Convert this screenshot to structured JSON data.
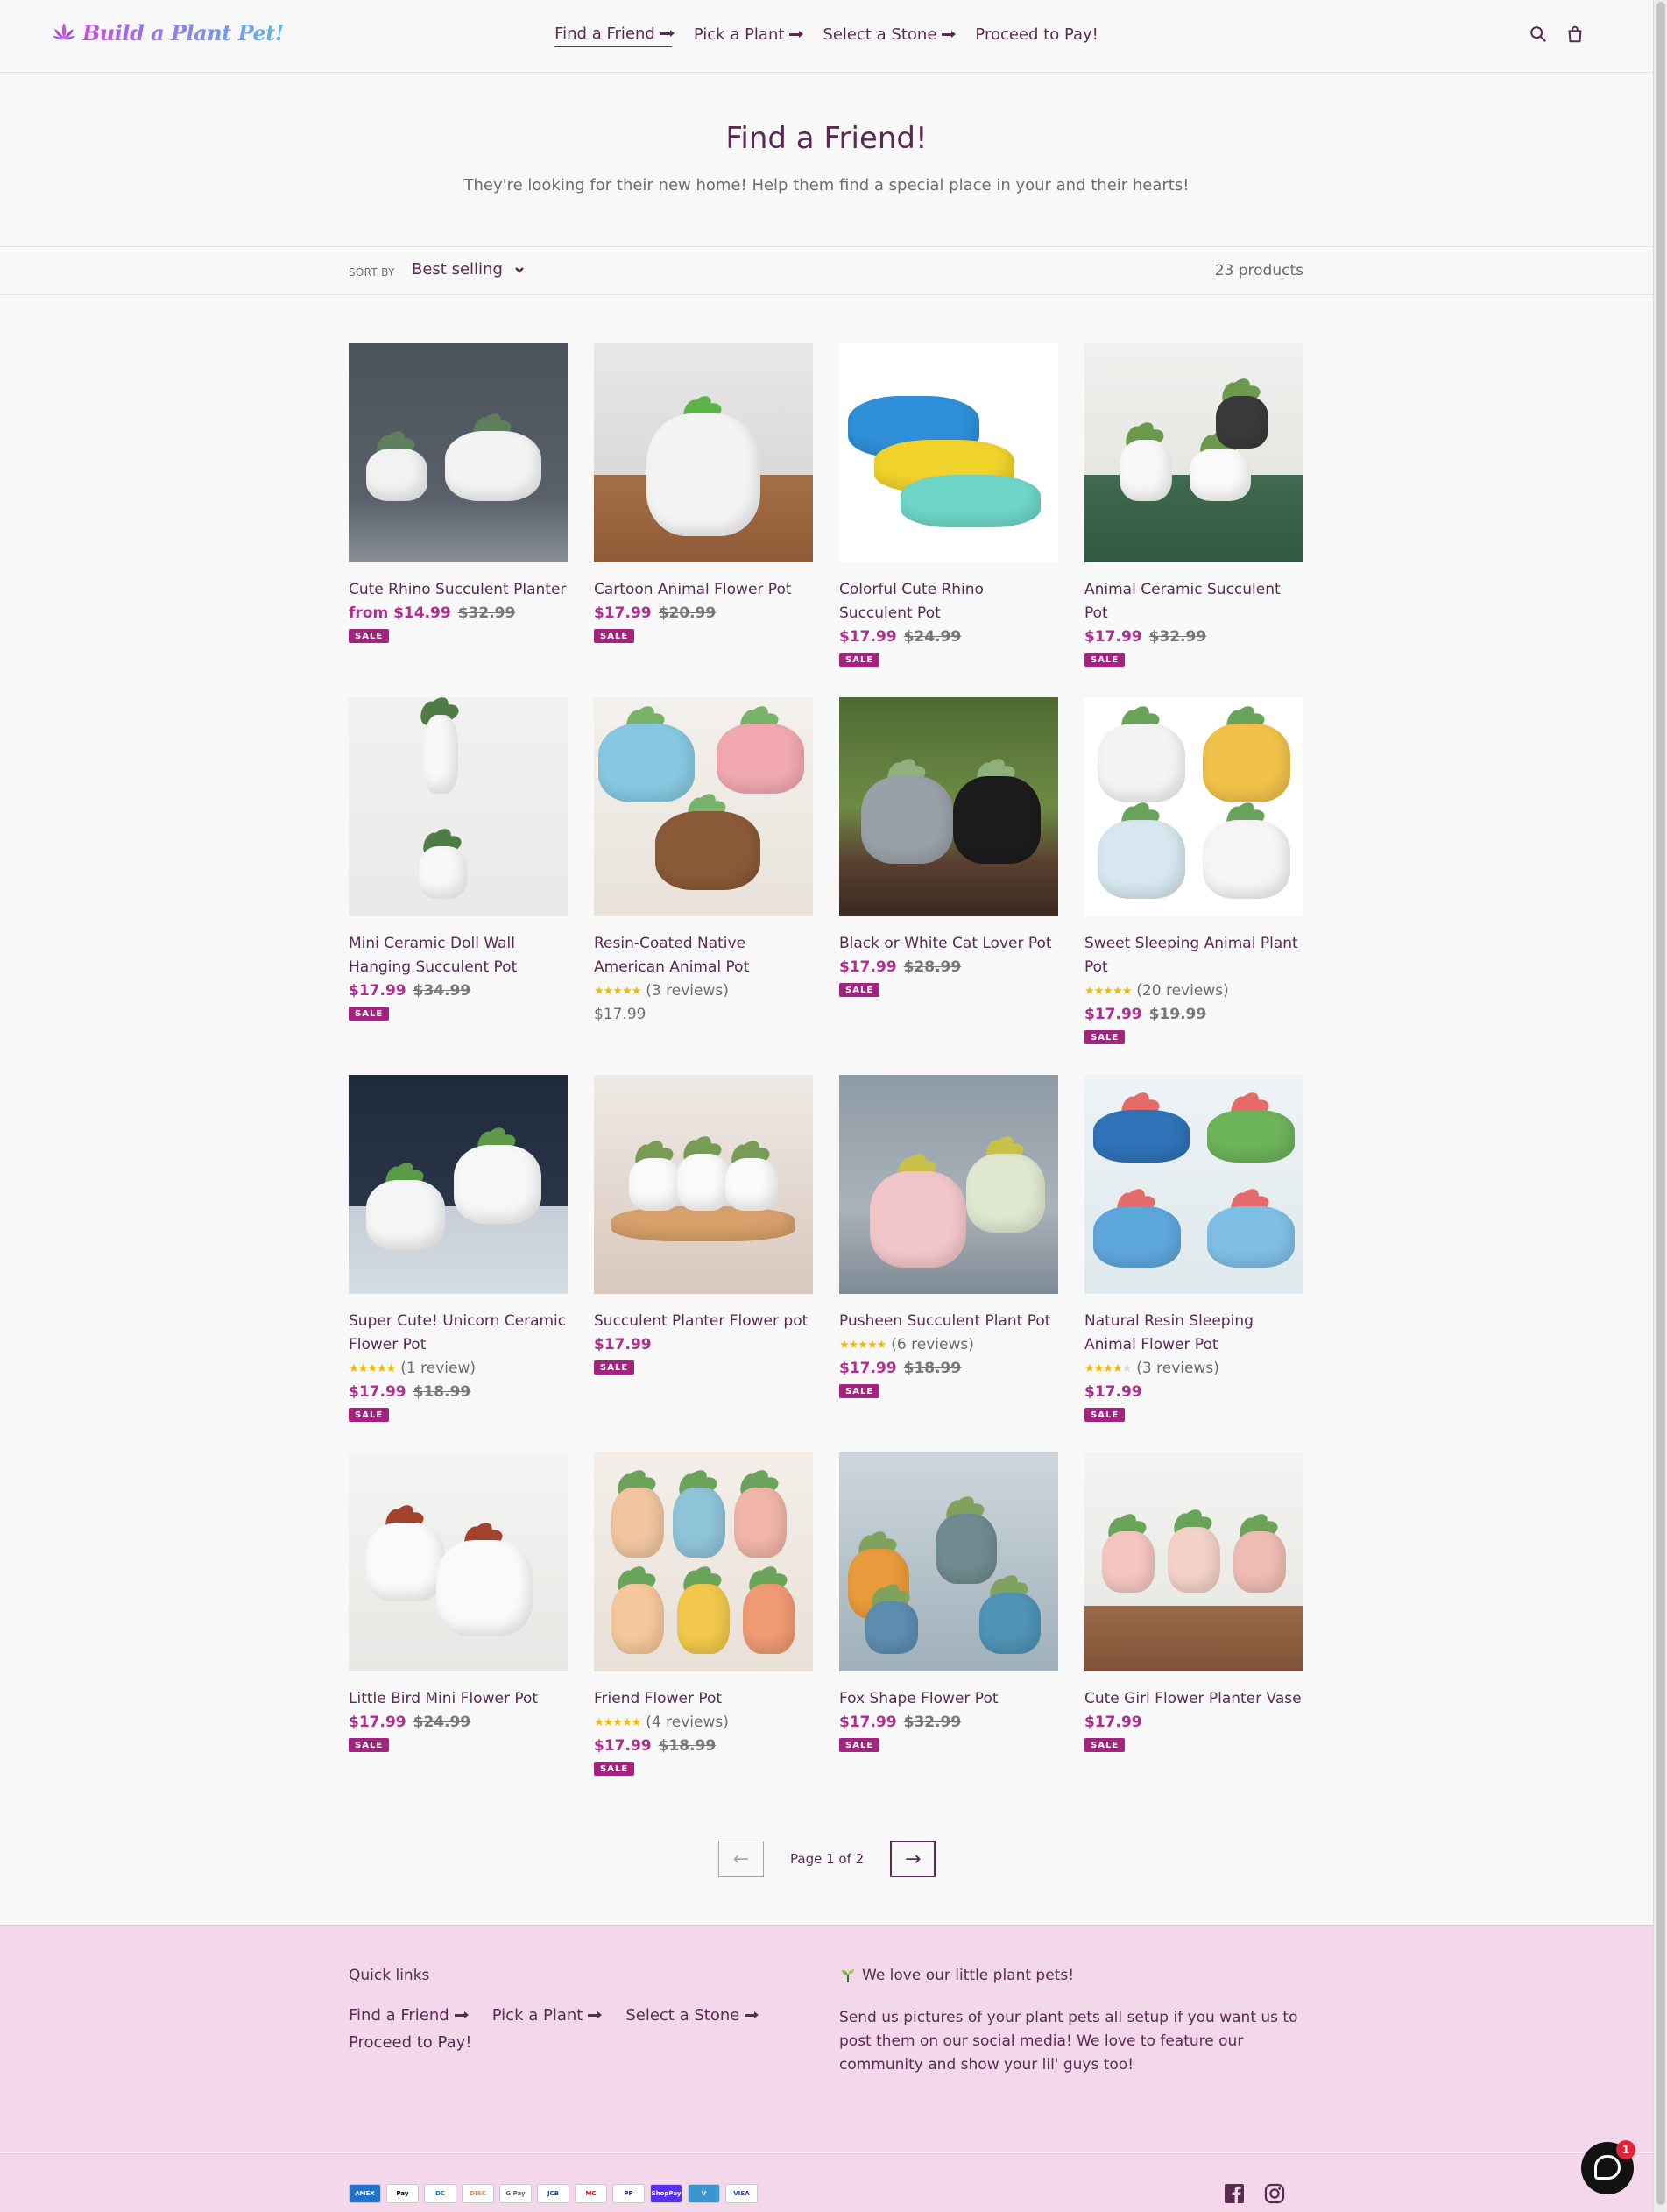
{
  "header": {
    "logo_text": "Build a Plant Pet!",
    "nav": [
      {
        "label": "Find a Friend",
        "active": true,
        "arrow": true
      },
      {
        "label": "Pick a Plant",
        "active": false,
        "arrow": true
      },
      {
        "label": "Select a Stone",
        "active": false,
        "arrow": true
      },
      {
        "label": "Proceed to Pay!",
        "active": false,
        "arrow": false
      }
    ]
  },
  "hero": {
    "title": "Find a Friend!",
    "subtitle": "They're looking for their new home! Help them find a special place in your and their hearts!"
  },
  "filter": {
    "sort_label": "SORT BY",
    "sort_value": "Best selling",
    "count": "23 products"
  },
  "products": [
    {
      "title": "Cute Rhino Succulent Planter",
      "price": "from $14.99",
      "was": "$32.99",
      "sale": "SALE"
    },
    {
      "title": "Cartoon Animal Flower Pot",
      "price": "$17.99",
      "was": "$20.99",
      "sale": "SALE"
    },
    {
      "title": "Colorful Cute Rhino Succulent Pot",
      "price": "$17.99",
      "was": "$24.99",
      "sale": "SALE"
    },
    {
      "title": "Animal Ceramic Succulent Pot",
      "price": "$17.99",
      "was": "$32.99",
      "sale": "SALE"
    },
    {
      "title": "Mini Ceramic Doll Wall Hanging Succulent Pot",
      "price": "$17.99",
      "was": "$34.99",
      "sale": "SALE"
    },
    {
      "title": "Resin-Coated Native American Animal Pot",
      "rating": 5,
      "reviews": "(3 reviews)",
      "price": "$17.99",
      "was": "",
      "sale": ""
    },
    {
      "title": "Black or White Cat Lover Pot",
      "price": "$17.99",
      "was": "$28.99",
      "sale": "SALE"
    },
    {
      "title": "Sweet Sleeping Animal Plant Pot",
      "rating": 5,
      "reviews": "(20 reviews)",
      "price": "$17.99",
      "was": "$19.99",
      "sale": "SALE"
    },
    {
      "title": "Super Cute! Unicorn Ceramic Flower Pot",
      "rating": 5,
      "reviews": "(1 review)",
      "price": "$17.99",
      "was": "$18.99",
      "sale": "SALE"
    },
    {
      "title": "Succulent Planter Flower pot",
      "price": "$17.99",
      "was": "",
      "sale": "SALE"
    },
    {
      "title": "Pusheen Succulent Plant Pot",
      "rating": 5,
      "reviews": "(6 reviews)",
      "price": "$17.99",
      "was": "$18.99",
      "sale": "SALE"
    },
    {
      "title": "Natural Resin Sleeping Animal Flower Pot",
      "rating": 4,
      "reviews": "(3 reviews)",
      "price": "$17.99",
      "was": "",
      "sale": "SALE"
    },
    {
      "title": "Little Bird Mini Flower Pot",
      "price": "$17.99",
      "was": "$24.99",
      "sale": "SALE"
    },
    {
      "title": "Friend Flower Pot",
      "rating": 5,
      "reviews": "(4 reviews)",
      "price": "$17.99",
      "was": "$18.99",
      "sale": "SALE"
    },
    {
      "title": "Fox Shape Flower Pot",
      "price": "$17.99",
      "was": "$32.99",
      "sale": "SALE"
    },
    {
      "title": "Cute Girl Flower Planter Vase",
      "price": "$17.99",
      "was": "",
      "sale": "SALE"
    }
  ],
  "pagination": {
    "text": "Page 1 of 2",
    "prev": "←",
    "next": "→"
  },
  "footer": {
    "quick_links_title": "Quick links",
    "links": [
      {
        "label": "Find a Friend",
        "arrow": true
      },
      {
        "label": "Pick a Plant",
        "arrow": true
      },
      {
        "label": "Select a Stone",
        "arrow": true
      },
      {
        "label": "Proceed to Pay!",
        "arrow": false
      }
    ],
    "about_title": "We love our little plant pets!",
    "about_text": "Send us pictures of your plant pets all setup if you want us to post them on our social media! We love to feature our community and show your lil' guys too!",
    "payments": [
      "AMEX",
      "Pay",
      "DC",
      "DISC",
      "G Pay",
      "JCB",
      "MC",
      "PP",
      "ShopPay",
      "V",
      "VISA"
    ]
  },
  "chat": {
    "badge": "1"
  },
  "colors": {
    "accent": "#5a2a52",
    "sale": "#a4237f",
    "price": "#b22b91",
    "footer_bg": "#f4d7ea"
  }
}
